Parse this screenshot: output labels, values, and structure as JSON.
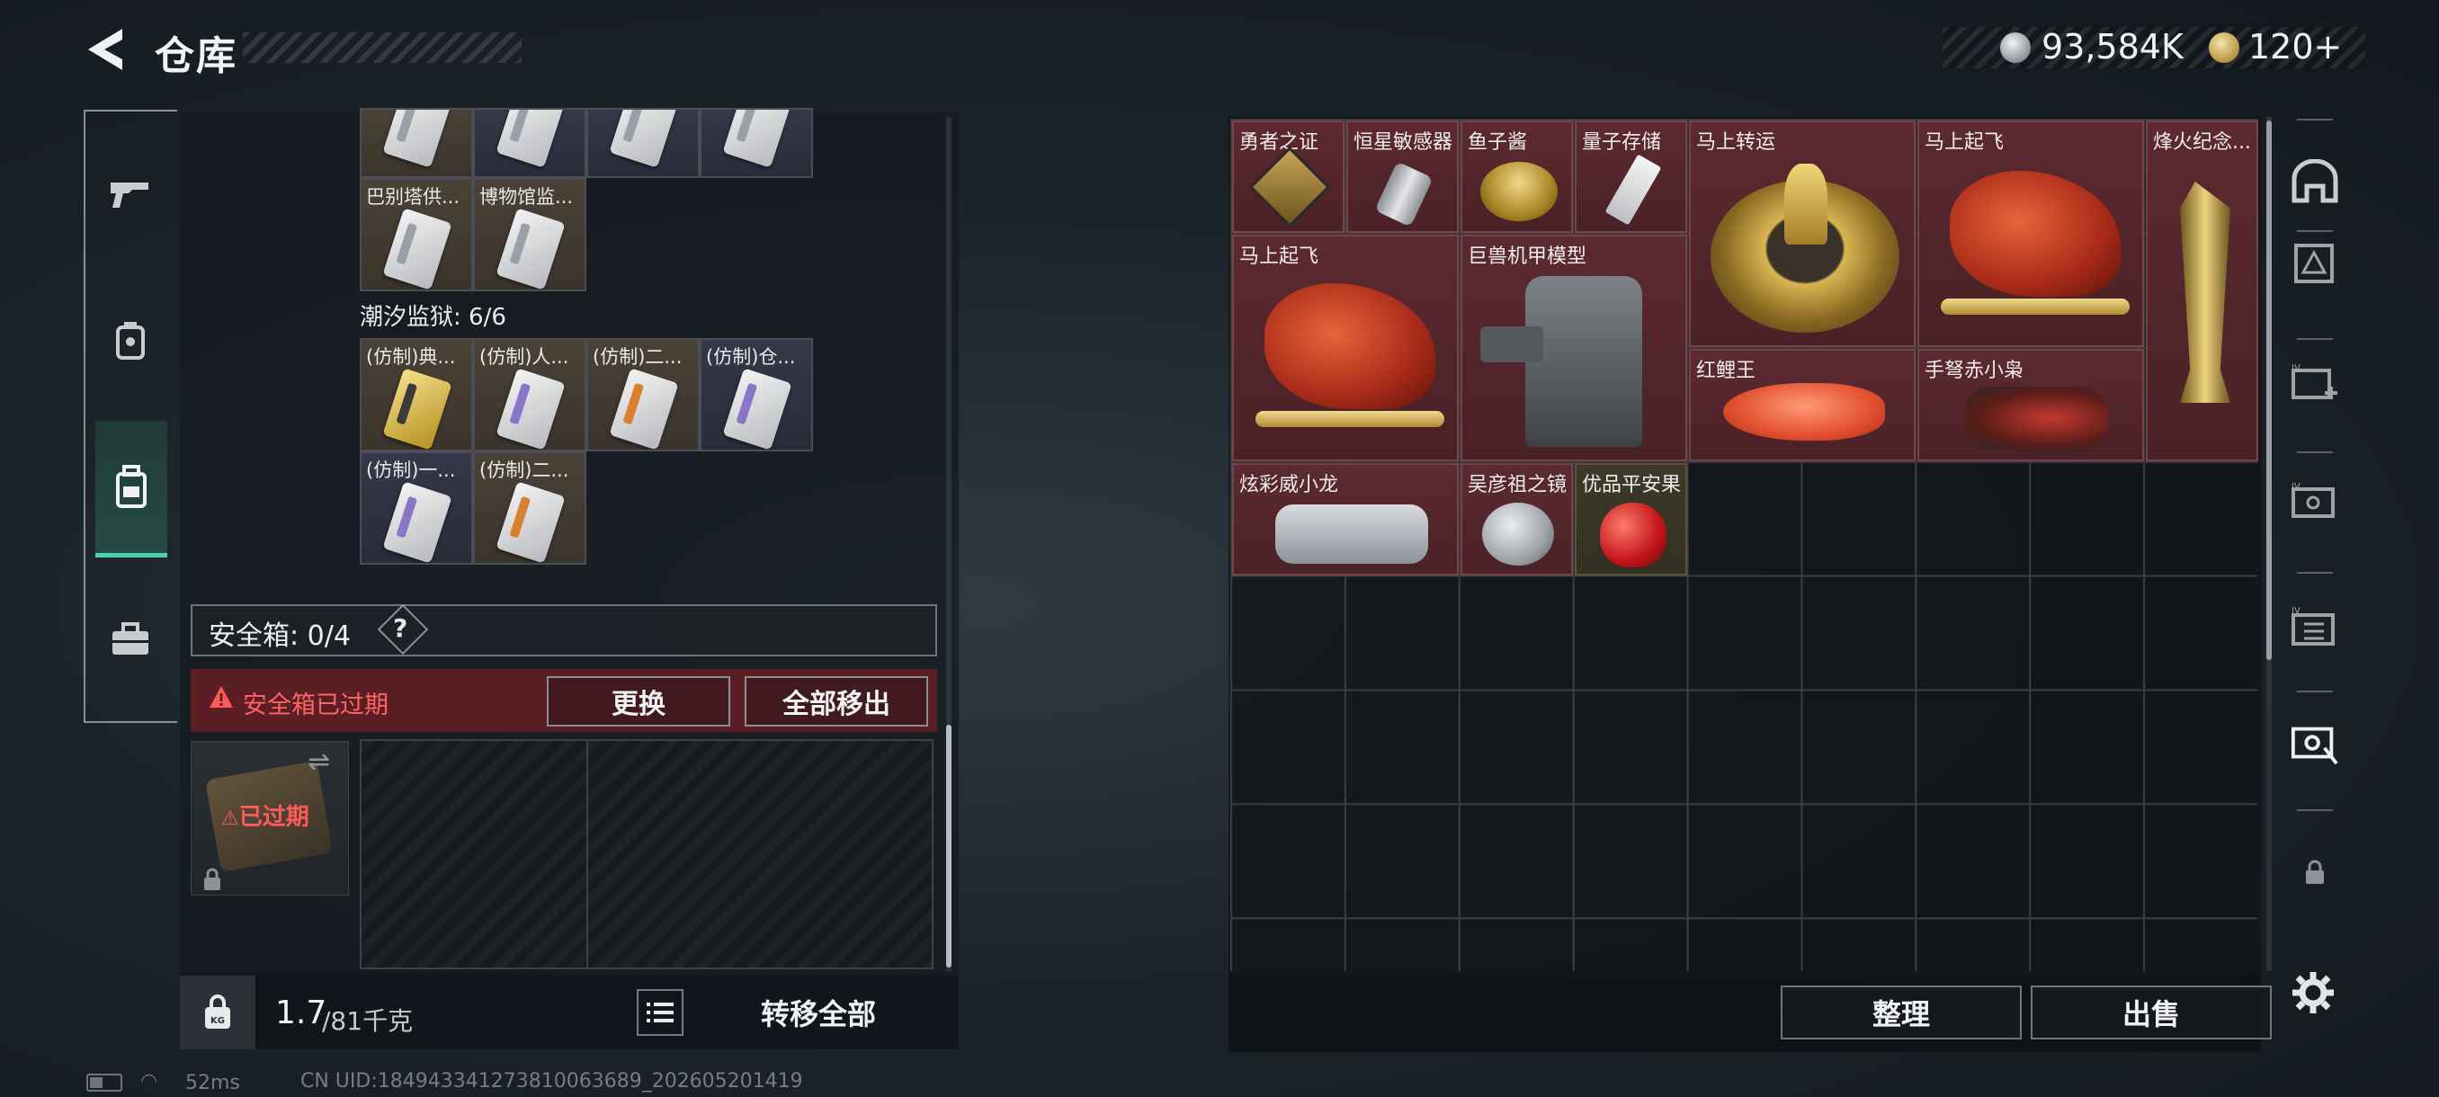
{
  "header": {
    "title": "仓库",
    "currency_silver": "93,584K",
    "currency_gold": "120+"
  },
  "nav": {
    "items": [
      "gun-icon",
      "armor-icon",
      "backpack-icon",
      "toolbox-icon"
    ],
    "active": 2
  },
  "left": {
    "partial_row": [
      "",
      "",
      "",
      ""
    ],
    "row2": [
      {
        "label": "巴别塔供...",
        "color": "brown"
      },
      {
        "label": "博物馆监...",
        "color": "brown"
      }
    ],
    "section": "潮汐监狱: 6/6",
    "prison_items": [
      {
        "label": "(仿制)典...",
        "color": "brown"
      },
      {
        "label": "(仿制)人...",
        "color": "brown"
      },
      {
        "label": "(仿制)二...",
        "color": "brown"
      },
      {
        "label": "(仿制)仓...",
        "color": "navy"
      },
      {
        "label": "(仿制)一...",
        "color": "navy"
      },
      {
        "label": "(仿制)二...",
        "color": "brown"
      }
    ],
    "safebox_label": "安全箱: 0/4",
    "help": "?",
    "expired_banner": "安全箱已过期",
    "replace_btn": "更换",
    "moveall_btn": "全部移出",
    "case_expired": "已过期",
    "weight_value": "1.7",
    "weight_cap": "/81千克",
    "transfer_all": "转移全部"
  },
  "right": {
    "items": [
      {
        "label": "勇者之证"
      },
      {
        "label": "恒星敏感器"
      },
      {
        "label": "鱼子酱"
      },
      {
        "label": "量子存储"
      },
      {
        "label": "马上转运"
      },
      {
        "label": "马上起飞"
      },
      {
        "label": "烽火纪念..."
      },
      {
        "label": "马上起飞"
      },
      {
        "label": "巨兽机甲模型"
      },
      {
        "label": "红鲤王"
      },
      {
        "label": "手弩赤小枭"
      },
      {
        "label": "炫彩威小龙"
      },
      {
        "label": "吴彦祖之镜"
      },
      {
        "label": "优品平安果"
      }
    ],
    "sort_btn": "整理",
    "sell_btn": "出售"
  },
  "side_icons": [
    "helmet-icon",
    "flag-icon",
    "card-plus-icon",
    "card-key-icon",
    "card-folder-icon",
    "card-key-active-icon",
    "lock-icon"
  ],
  "status": {
    "ping": "52ms",
    "uid": "CN UID:1849433412738100636​89_202605201419"
  },
  "colors": {
    "accent": "#4fd0b2",
    "expired_red": "#ff5a5a",
    "item_red": "#5c2a30"
  }
}
